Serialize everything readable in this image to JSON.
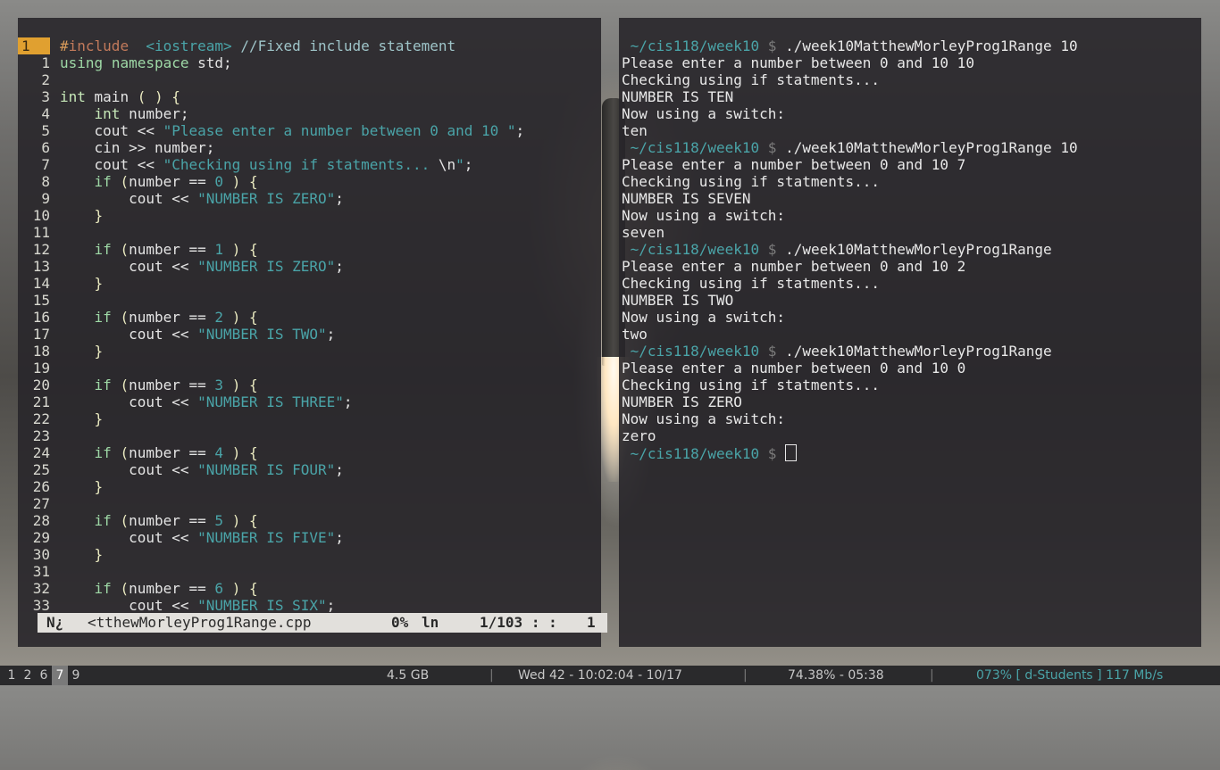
{
  "editor": {
    "lines": [
      {
        "n": "1",
        "parts": [
          [
            "pp",
            "#"
          ],
          [
            "kw-inc",
            "include"
          ],
          [
            "",
            "  "
          ],
          [
            "str",
            "<iostream>"
          ],
          [
            "",
            " "
          ],
          [
            "cm",
            "//Fixed include statement"
          ]
        ],
        "cursor": true
      },
      {
        "n": "1",
        "parts": [
          [
            "kw",
            "using"
          ],
          [
            "",
            " "
          ],
          [
            "kw",
            "namespace"
          ],
          [
            "",
            " std;"
          ]
        ]
      },
      {
        "n": "2",
        "parts": []
      },
      {
        "n": "3",
        "parts": [
          [
            "type",
            "int"
          ],
          [
            "",
            " main "
          ],
          [
            "paren",
            "( )"
          ],
          [
            "",
            " "
          ],
          [
            "paren",
            "{"
          ]
        ]
      },
      {
        "n": "4",
        "parts": [
          [
            "",
            "    "
          ],
          [
            "type",
            "int"
          ],
          [
            "",
            " number;"
          ]
        ]
      },
      {
        "n": "5",
        "parts": [
          [
            "",
            "    cout << "
          ],
          [
            "str",
            "\"Please enter a number between 0 and 10 \""
          ],
          [
            "",
            ";"
          ]
        ]
      },
      {
        "n": "6",
        "parts": [
          [
            "",
            "    cin >> number;"
          ]
        ]
      },
      {
        "n": "7",
        "parts": [
          [
            "",
            "    cout << "
          ],
          [
            "str",
            "\"Checking using if statments... "
          ],
          [
            "",
            "\\n"
          ],
          [
            "str",
            "\""
          ],
          [
            "",
            ";"
          ]
        ]
      },
      {
        "n": "8",
        "parts": [
          [
            "",
            "    "
          ],
          [
            "kw",
            "if"
          ],
          [
            "",
            " "
          ],
          [
            "paren",
            "("
          ],
          [
            "",
            "number == "
          ],
          [
            "num",
            "0"
          ],
          [
            "",
            " "
          ],
          [
            "paren",
            ")"
          ],
          [
            "",
            " "
          ],
          [
            "paren",
            "{"
          ]
        ]
      },
      {
        "n": "9",
        "parts": [
          [
            "",
            "        cout << "
          ],
          [
            "str",
            "\"NUMBER IS ZERO\""
          ],
          [
            "",
            ";"
          ]
        ]
      },
      {
        "n": "10",
        "parts": [
          [
            "",
            "    "
          ],
          [
            "paren",
            "}"
          ]
        ]
      },
      {
        "n": "11",
        "parts": []
      },
      {
        "n": "12",
        "parts": [
          [
            "",
            "    "
          ],
          [
            "kw",
            "if"
          ],
          [
            "",
            " "
          ],
          [
            "paren",
            "("
          ],
          [
            "",
            "number == "
          ],
          [
            "num",
            "1"
          ],
          [
            "",
            " "
          ],
          [
            "paren",
            ")"
          ],
          [
            "",
            " "
          ],
          [
            "paren",
            "{"
          ]
        ]
      },
      {
        "n": "13",
        "parts": [
          [
            "",
            "        cout << "
          ],
          [
            "str",
            "\"NUMBER IS ZERO\""
          ],
          [
            "",
            ";"
          ]
        ]
      },
      {
        "n": "14",
        "parts": [
          [
            "",
            "    "
          ],
          [
            "paren",
            "}"
          ]
        ]
      },
      {
        "n": "15",
        "parts": []
      },
      {
        "n": "16",
        "parts": [
          [
            "",
            "    "
          ],
          [
            "kw",
            "if"
          ],
          [
            "",
            " "
          ],
          [
            "paren",
            "("
          ],
          [
            "",
            "number == "
          ],
          [
            "num",
            "2"
          ],
          [
            "",
            " "
          ],
          [
            "paren",
            ")"
          ],
          [
            "",
            " "
          ],
          [
            "paren",
            "{"
          ]
        ]
      },
      {
        "n": "17",
        "parts": [
          [
            "",
            "        cout << "
          ],
          [
            "str",
            "\"NUMBER IS TWO\""
          ],
          [
            "",
            ";"
          ]
        ]
      },
      {
        "n": "18",
        "parts": [
          [
            "",
            "    "
          ],
          [
            "paren",
            "}"
          ]
        ]
      },
      {
        "n": "19",
        "parts": []
      },
      {
        "n": "20",
        "parts": [
          [
            "",
            "    "
          ],
          [
            "kw",
            "if"
          ],
          [
            "",
            " "
          ],
          [
            "paren",
            "("
          ],
          [
            "",
            "number == "
          ],
          [
            "num",
            "3"
          ],
          [
            "",
            " "
          ],
          [
            "paren",
            ")"
          ],
          [
            "",
            " "
          ],
          [
            "paren",
            "{"
          ]
        ]
      },
      {
        "n": "21",
        "parts": [
          [
            "",
            "        cout << "
          ],
          [
            "str",
            "\"NUMBER IS THREE\""
          ],
          [
            "",
            ";"
          ]
        ]
      },
      {
        "n": "22",
        "parts": [
          [
            "",
            "    "
          ],
          [
            "paren",
            "}"
          ]
        ]
      },
      {
        "n": "23",
        "parts": []
      },
      {
        "n": "24",
        "parts": [
          [
            "",
            "    "
          ],
          [
            "kw",
            "if"
          ],
          [
            "",
            " "
          ],
          [
            "paren",
            "("
          ],
          [
            "",
            "number == "
          ],
          [
            "num",
            "4"
          ],
          [
            "",
            " "
          ],
          [
            "paren",
            ")"
          ],
          [
            "",
            " "
          ],
          [
            "paren",
            "{"
          ]
        ]
      },
      {
        "n": "25",
        "parts": [
          [
            "",
            "        cout << "
          ],
          [
            "str",
            "\"NUMBER IS FOUR\""
          ],
          [
            "",
            ";"
          ]
        ]
      },
      {
        "n": "26",
        "parts": [
          [
            "",
            "    "
          ],
          [
            "paren",
            "}"
          ]
        ]
      },
      {
        "n": "27",
        "parts": []
      },
      {
        "n": "28",
        "parts": [
          [
            "",
            "    "
          ],
          [
            "kw",
            "if"
          ],
          [
            "",
            " "
          ],
          [
            "paren",
            "("
          ],
          [
            "",
            "number == "
          ],
          [
            "num",
            "5"
          ],
          [
            "",
            " "
          ],
          [
            "paren",
            ")"
          ],
          [
            "",
            " "
          ],
          [
            "paren",
            "{"
          ]
        ]
      },
      {
        "n": "29",
        "parts": [
          [
            "",
            "        cout << "
          ],
          [
            "str",
            "\"NUMBER IS FIVE\""
          ],
          [
            "",
            ";"
          ]
        ]
      },
      {
        "n": "30",
        "parts": [
          [
            "",
            "    "
          ],
          [
            "paren",
            "}"
          ]
        ]
      },
      {
        "n": "31",
        "parts": []
      },
      {
        "n": "32",
        "parts": [
          [
            "",
            "    "
          ],
          [
            "kw",
            "if"
          ],
          [
            "",
            " "
          ],
          [
            "paren",
            "("
          ],
          [
            "",
            "number == "
          ],
          [
            "num",
            "6"
          ],
          [
            "",
            " "
          ],
          [
            "paren",
            ")"
          ],
          [
            "",
            " "
          ],
          [
            "paren",
            "{"
          ]
        ]
      },
      {
        "n": "33",
        "parts": [
          [
            "",
            "        cout << "
          ],
          [
            "str",
            "\"NUMBER IS SIX\""
          ],
          [
            "",
            ";"
          ]
        ]
      }
    ],
    "status": {
      "mode": "N¿",
      "file": "<tthewMorleyProg1Range.cpp",
      "percent": "0%",
      "ln": "ln",
      "position": "1/103",
      "sep": ": :",
      "col": "1"
    }
  },
  "terminal": {
    "lines": [
      {
        "type": "prompt",
        "path": "~/cis118/week10",
        "sym": "$",
        "cmd": "./week10MatthewMorleyProg1Range 10"
      },
      {
        "type": "out",
        "text": "Please enter a number between 0 and 10 10"
      },
      {
        "type": "out",
        "text": "Checking using if statments..."
      },
      {
        "type": "out",
        "text": "NUMBER IS TEN"
      },
      {
        "type": "out",
        "text": "Now using a switch:"
      },
      {
        "type": "out",
        "text": "ten"
      },
      {
        "type": "prompt",
        "path": "~/cis118/week10",
        "sym": "$",
        "cmd": "./week10MatthewMorleyProg1Range 10"
      },
      {
        "type": "out",
        "text": "Please enter a number between 0 and 10 7"
      },
      {
        "type": "out",
        "text": "Checking using if statments..."
      },
      {
        "type": "out",
        "text": "NUMBER IS SEVEN"
      },
      {
        "type": "out",
        "text": "Now using a switch:"
      },
      {
        "type": "out",
        "text": "seven"
      },
      {
        "type": "prompt",
        "path": "~/cis118/week10",
        "sym": "$",
        "cmd": "./week10MatthewMorleyProg1Range"
      },
      {
        "type": "out",
        "text": "Please enter a number between 0 and 10 2"
      },
      {
        "type": "out",
        "text": "Checking using if statments..."
      },
      {
        "type": "out",
        "text": "NUMBER IS TWO"
      },
      {
        "type": "out",
        "text": "Now using a switch:"
      },
      {
        "type": "out",
        "text": "two"
      },
      {
        "type": "prompt",
        "path": "~/cis118/week10",
        "sym": "$",
        "cmd": "./week10MatthewMorleyProg1Range"
      },
      {
        "type": "out",
        "text": "Please enter a number between 0 and 10 0"
      },
      {
        "type": "out",
        "text": "Checking using if statments..."
      },
      {
        "type": "out",
        "text": "NUMBER IS ZERO"
      },
      {
        "type": "out",
        "text": "Now using a switch:"
      },
      {
        "type": "out",
        "text": "zero"
      },
      {
        "type": "prompt",
        "path": "~/cis118/week10",
        "sym": "$",
        "cmd": "",
        "cursor": true
      }
    ]
  },
  "bar": {
    "workspaces": [
      "1",
      "2",
      "6",
      "7",
      "9"
    ],
    "active_workspace": "7",
    "memory": "4.5 GB",
    "datetime": "Wed 42 - 10:02:04 - 10/17",
    "battery": "74.38% - 05:38",
    "network": "073% [ d-Students ] 117 Mb/s",
    "separator": "|"
  }
}
